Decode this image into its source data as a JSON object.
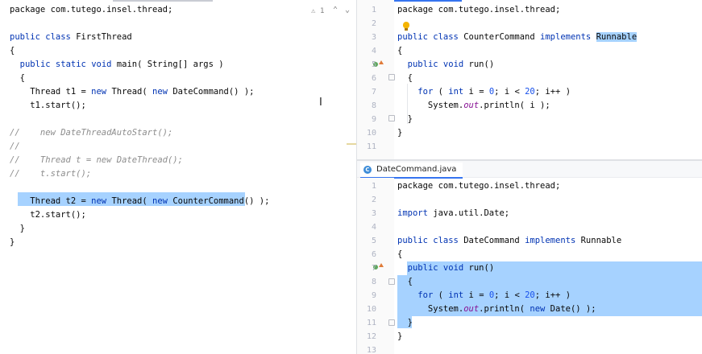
{
  "left_editor": {
    "lines": [
      [
        {
          "t": "package com.tutego.insel.thread;",
          "c": ""
        }
      ],
      [],
      [
        {
          "t": "public ",
          "c": "kw"
        },
        {
          "t": "class ",
          "c": "kw"
        },
        {
          "t": "FirstThread",
          "c": ""
        }
      ],
      [
        {
          "t": "{",
          "c": ""
        }
      ],
      [
        {
          "t": "  ",
          "c": ""
        },
        {
          "t": "public ",
          "c": "kw"
        },
        {
          "t": "static ",
          "c": "kw"
        },
        {
          "t": "void ",
          "c": "kw"
        },
        {
          "t": "main( String[] args )",
          "c": ""
        }
      ],
      [
        {
          "t": "  {",
          "c": ""
        }
      ],
      [
        {
          "t": "    Thread t1 = ",
          "c": ""
        },
        {
          "t": "new ",
          "c": "kw"
        },
        {
          "t": "Thread( ",
          "c": ""
        },
        {
          "t": "new ",
          "c": "kw"
        },
        {
          "t": "DateCommand() );",
          "c": ""
        }
      ],
      [
        {
          "t": "    t1.start();",
          "c": ""
        }
      ],
      [],
      [
        {
          "t": "//    new DateThreadAutoStart();",
          "c": "cm"
        }
      ],
      [
        {
          "t": "//",
          "c": "cm"
        }
      ],
      [
        {
          "t": "//    Thread t = new DateThread();",
          "c": "cm"
        }
      ],
      [
        {
          "t": "//    t.start();",
          "c": "cm"
        }
      ],
      [],
      [
        {
          "t": "    Thread t2 = ",
          "c": ""
        },
        {
          "t": "new ",
          "c": "kw"
        },
        {
          "t": "Thread( ",
          "c": ""
        },
        {
          "t": "new ",
          "c": "kw"
        },
        {
          "t": "CounterCommand() );",
          "c": ""
        }
      ],
      [
        {
          "t": "    t2.start();",
          "c": ""
        }
      ],
      [
        {
          "t": "  }",
          "c": ""
        }
      ],
      [
        {
          "t": "}",
          "c": ""
        }
      ]
    ],
    "warning_count": "1",
    "warning_icon": "warning-triangle-icon",
    "nav_up": "^",
    "nav_down": "v",
    "text_cursor": "I"
  },
  "right_top_editor": {
    "line_numbers": [
      "1",
      "2",
      "3",
      "4",
      "5",
      "6",
      "7",
      "8",
      "9",
      "10",
      "11"
    ],
    "lines": [
      [
        {
          "t": "package com.tutego.insel.thread;",
          "c": ""
        }
      ],
      [],
      [
        {
          "t": "public ",
          "c": "kw"
        },
        {
          "t": "class ",
          "c": "kw"
        },
        {
          "t": "CounterCommand ",
          "c": ""
        },
        {
          "t": "implements ",
          "c": "kw"
        },
        {
          "t": "Runnable",
          "c": "hl"
        }
      ],
      [
        {
          "t": "{",
          "c": ""
        }
      ],
      [
        {
          "t": "  ",
          "c": ""
        },
        {
          "t": "public ",
          "c": "kw"
        },
        {
          "t": "void ",
          "c": "kw"
        },
        {
          "t": "run()",
          "c": ""
        }
      ],
      [
        {
          "t": "  {",
          "c": ""
        }
      ],
      [
        {
          "t": "    ",
          "c": ""
        },
        {
          "t": "for ",
          "c": "kw"
        },
        {
          "t": "( ",
          "c": ""
        },
        {
          "t": "int ",
          "c": "kw"
        },
        {
          "t": "i = ",
          "c": ""
        },
        {
          "t": "0",
          "c": "num"
        },
        {
          "t": "; i < ",
          "c": ""
        },
        {
          "t": "20",
          "c": "num"
        },
        {
          "t": "; i++ )",
          "c": ""
        }
      ],
      [
        {
          "t": "      System.",
          "c": ""
        },
        {
          "t": "out",
          "c": "it"
        },
        {
          "t": ".println( i );",
          "c": ""
        }
      ],
      [
        {
          "t": "  }",
          "c": ""
        }
      ],
      [
        {
          "t": "}",
          "c": ""
        }
      ],
      []
    ]
  },
  "right_bottom_editor": {
    "tab_label": "DateCommand.java",
    "tab_icon": "C",
    "line_numbers": [
      "1",
      "2",
      "3",
      "4",
      "5",
      "6",
      "7",
      "8",
      "9",
      "10",
      "11",
      "12",
      "13"
    ],
    "lines": [
      [
        {
          "t": "package com.tutego.insel.thread;",
          "c": ""
        }
      ],
      [],
      [
        {
          "t": "import ",
          "c": "kw"
        },
        {
          "t": "java.util.Date;",
          "c": ""
        }
      ],
      [],
      [
        {
          "t": "public ",
          "c": "kw"
        },
        {
          "t": "class ",
          "c": "kw"
        },
        {
          "t": "DateCommand ",
          "c": ""
        },
        {
          "t": "implements ",
          "c": "kw"
        },
        {
          "t": "Runnable",
          "c": ""
        }
      ],
      [
        {
          "t": "{",
          "c": ""
        }
      ],
      [
        {
          "t": "  ",
          "c": ""
        },
        {
          "t": "public ",
          "c": "kw"
        },
        {
          "t": "void ",
          "c": "kw"
        },
        {
          "t": "run()",
          "c": ""
        }
      ],
      [
        {
          "t": "  {",
          "c": ""
        }
      ],
      [
        {
          "t": "    ",
          "c": ""
        },
        {
          "t": "for ",
          "c": "kw"
        },
        {
          "t": "( ",
          "c": ""
        },
        {
          "t": "int ",
          "c": "kw"
        },
        {
          "t": "i = ",
          "c": ""
        },
        {
          "t": "0",
          "c": "num"
        },
        {
          "t": "; i < ",
          "c": ""
        },
        {
          "t": "20",
          "c": "num"
        },
        {
          "t": "; i++ )",
          "c": ""
        }
      ],
      [
        {
          "t": "      System.",
          "c": ""
        },
        {
          "t": "out",
          "c": "it"
        },
        {
          "t": ".println( ",
          "c": ""
        },
        {
          "t": "new ",
          "c": "kw"
        },
        {
          "t": "Date() );",
          "c": ""
        }
      ],
      [
        {
          "t": "  }",
          "c": ""
        }
      ],
      [
        {
          "t": "}",
          "c": ""
        }
      ],
      []
    ]
  },
  "colors": {
    "keyword": "#0033b3",
    "comment": "#8c8c8c",
    "number": "#1750eb",
    "static_field": "#871094",
    "selection": "#a6d2ff",
    "line_number": "#aeb3c2"
  }
}
